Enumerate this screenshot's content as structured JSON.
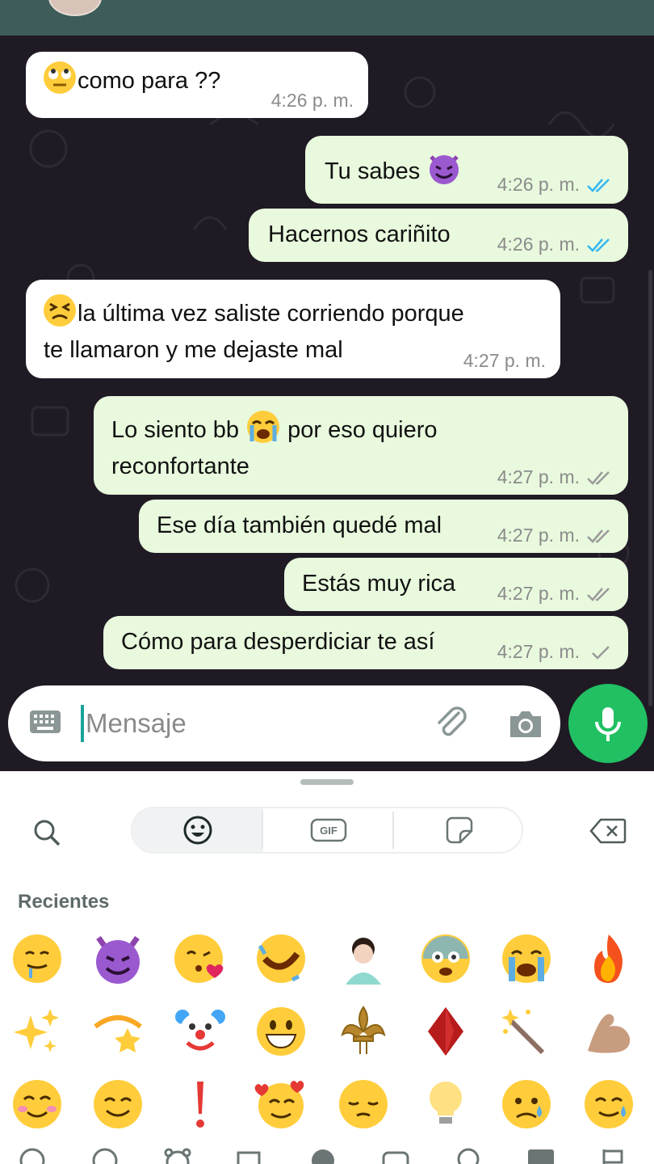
{
  "composer": {
    "placeholder": "Mensaje"
  },
  "messages": [
    {
      "dir": "in",
      "text": "como para ??",
      "emoji": "rolling-eyes",
      "time": "4:26 p. m.",
      "status": ""
    },
    {
      "dir": "out",
      "text": "Tu sabes",
      "emoji_after": "smiling-devil",
      "time": "4:26 p. m.",
      "status": "read"
    },
    {
      "dir": "out",
      "text": "Hacernos cariñito",
      "time": "4:26 p. m.",
      "status": "read"
    },
    {
      "dir": "in",
      "line1": "la última vez saliste corriendo porque",
      "line2": "te llamaron y me dejaste mal",
      "emoji": "persevering-face",
      "time": "4:27 p. m.",
      "status": ""
    },
    {
      "dir": "out",
      "line1a": "Lo siento bb",
      "line1b": "por eso quiero",
      "line2": "reconfortante",
      "emoji_mid": "loudly-crying",
      "time": "4:27 p. m.",
      "status": "delivered"
    },
    {
      "dir": "out",
      "text": "Ese día también quedé mal",
      "time": "4:27 p. m.",
      "status": "delivered"
    },
    {
      "dir": "out",
      "text": "Estás muy rica",
      "time": "4:27 p. m.",
      "status": "delivered"
    },
    {
      "dir": "out",
      "text": "Cómo para desperdiciar te así",
      "time": "4:27 p. m.",
      "status": "sent"
    }
  ],
  "emoji_panel": {
    "section_label": "Recientes",
    "tabs": [
      "emoji",
      "gif",
      "sticker"
    ],
    "active_tab": "emoji",
    "recent": [
      "drooling-face",
      "smiling-devil",
      "kissing-heart",
      "rofl",
      "facepalm",
      "fearful-face",
      "loudly-crying",
      "fire",
      "sparkles",
      "dizzy-star",
      "clown",
      "grinning-face",
      "fleur-de-lis",
      "red-diamond",
      "magic-wand",
      "flexed-biceps",
      "smiling-blush",
      "smiling-face",
      "exclamation",
      "smiling-hearts",
      "pensive",
      "light-bulb",
      "sad-tear",
      "smiling-tear"
    ],
    "categories": [
      "recent",
      "smileys",
      "animals",
      "food",
      "activities",
      "travel",
      "objects",
      "symbols",
      "flags"
    ]
  },
  "colors": {
    "header": "#3d5c5a",
    "chat_bg": "#1f1a24",
    "incoming": "#ffffff",
    "outgoing": "#e8f9dd",
    "read_tick": "#34b7f1",
    "mic": "#21c063"
  }
}
